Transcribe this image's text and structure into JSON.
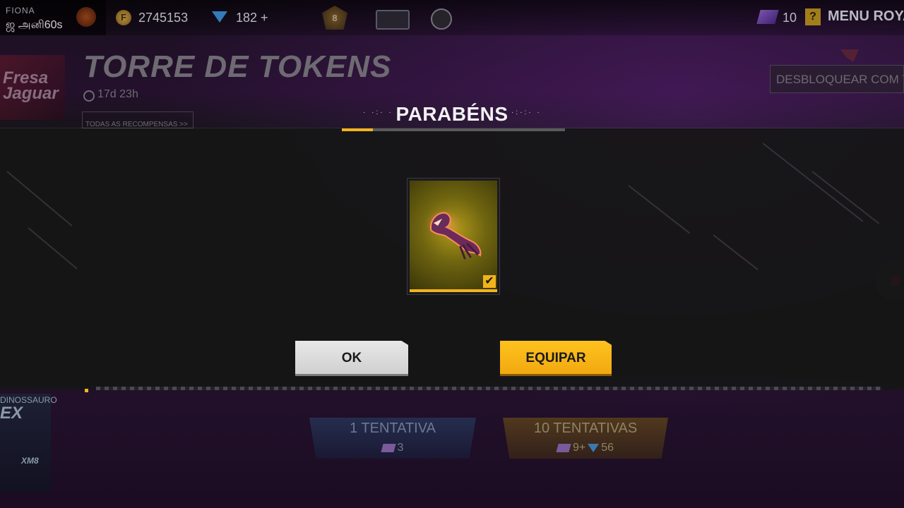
{
  "topbar": {
    "player_tag": "FIONA",
    "player_name": "ஜ அனி60s",
    "coins": "2745153",
    "diamonds": "182 +",
    "rank_level": "8",
    "token_count": "10",
    "help_glyph": "?",
    "menu_label": "MENU ROYALE"
  },
  "event": {
    "title": "TORRE DE TOKENS",
    "timer": "17d 23h",
    "all_rewards": "TODAS AS RECOMPENSAS >>",
    "unlock_button": "DESBLOQUEAR COM TOKENS",
    "side_card_name": "DINOSSAURO",
    "side_card_ex": "EX",
    "side_card_sub": "XM8"
  },
  "spins": {
    "single_label": "1 TENTATIVA",
    "single_cost": "3",
    "ten_label": "10 TENTATIVAS",
    "ten_cost_tokens": "9",
    "ten_cost_plus": "+",
    "ten_cost_diamonds": "56"
  },
  "modal": {
    "title": "PARABÉNS",
    "title_deco_left": "· ·:· ·",
    "title_deco_right": "·:·:· ·",
    "reward_icon": "creature-emote-icon",
    "check_glyph": "✔",
    "ok_label": "OK",
    "equip_label": "EQUIPAR"
  },
  "colors": {
    "accent_yellow": "#f2b41c",
    "ok_gray": "#dcdcdc",
    "overlay": "#161616",
    "purple_bg": "#24102c"
  }
}
